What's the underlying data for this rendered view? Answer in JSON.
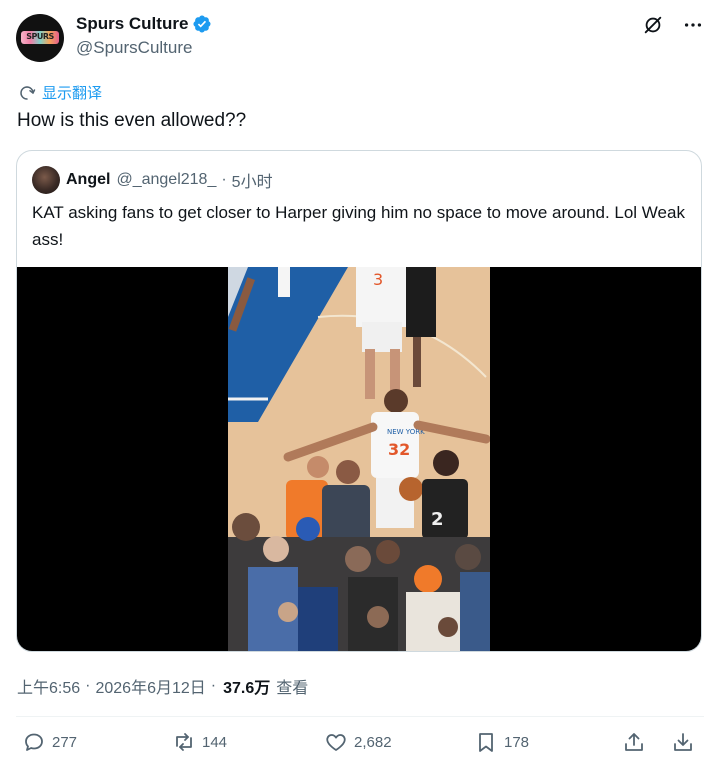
{
  "author": {
    "display_name": "Spurs Culture",
    "handle": "@SpursCulture",
    "avatar_text": "SPURS"
  },
  "translate_label": "显示翻译",
  "tweet_text": "How is this even allowed??",
  "quote": {
    "display_name": "Angel",
    "handle": "@_angel218_",
    "separator": "·",
    "time": "5小时",
    "text": "KAT asking fans to get closer to Harper giving him no space to move around. Lol Weak ass!"
  },
  "video": {
    "jersey_number": "32",
    "jersey_text": "NEW YORK",
    "opponent_number": "2",
    "other_number": "3"
  },
  "meta": {
    "time": "上午6:56",
    "date": "2026年6月12日",
    "separator": "·",
    "views": "37.6万",
    "views_label": "查看"
  },
  "actions": {
    "replies": "277",
    "reposts": "144",
    "likes": "2,682",
    "bookmarks": "178"
  },
  "colors": {
    "accent": "#1d9bf0",
    "muted": "#536471",
    "border": "#cfd9de"
  }
}
